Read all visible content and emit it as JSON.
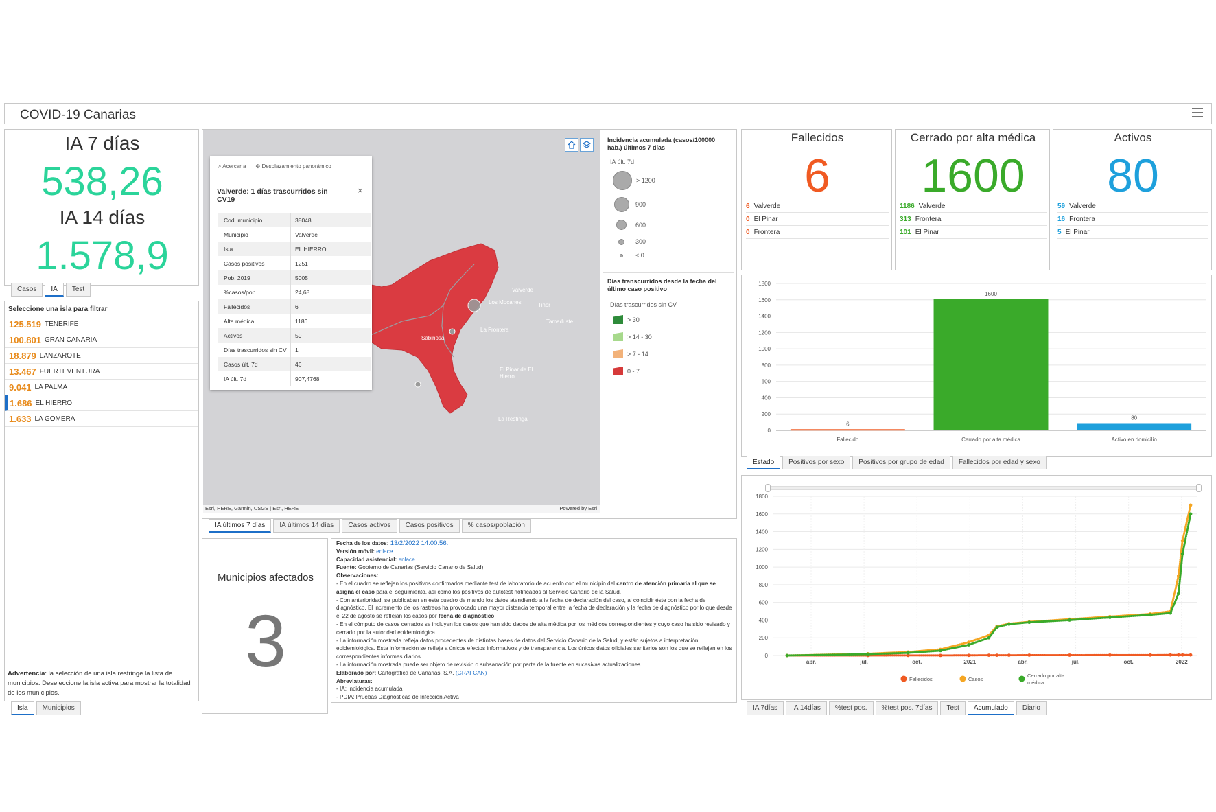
{
  "app_title": "COVID-19 Canarias",
  "ia": {
    "label7": "IA 7 días",
    "value7": "538,26",
    "label14": "IA 14 días",
    "value14": "1.578,9",
    "color": "#2bd49a"
  },
  "left_tabs": [
    "Casos",
    "IA",
    "Test"
  ],
  "island_list": {
    "header": "Seleccione una isla para filtrar",
    "items": [
      {
        "value": "125.519",
        "name": "TENERIFE"
      },
      {
        "value": "100.801",
        "name": "GRAN CANARIA"
      },
      {
        "value": "18.879",
        "name": "LANZAROTE"
      },
      {
        "value": "13.467",
        "name": "FUERTEVENTURA"
      },
      {
        "value": "9.041",
        "name": "LA PALMA"
      },
      {
        "value": "1.686",
        "name": "EL HIERRO"
      },
      {
        "value": "1.633",
        "name": "LA GOMERA"
      }
    ],
    "warning_bold": "Advertencia",
    "warning_text": ": la selección de una isla restringe la lista de municipios. Deseleccione la isla activa para mostrar la totalidad de los municipios."
  },
  "bottom_left_tabs": [
    "Isla",
    "Municipios"
  ],
  "map": {
    "toolbar": {
      "zoom": "Acercar a",
      "pan": "Desplazamiento panorámico"
    },
    "popup_title": "Valverde: 1 días trascurridos sin CV19",
    "popup_rows": [
      {
        "k": "Cod. municipio",
        "v": "38048"
      },
      {
        "k": "Municipio",
        "v": "Valverde"
      },
      {
        "k": "Isla",
        "v": "EL HIERRO"
      },
      {
        "k": "Casos positivos",
        "v": "1251"
      },
      {
        "k": "Pob. 2019",
        "v": "5005"
      },
      {
        "k": "%casos/pob.",
        "v": "24,68"
      },
      {
        "k": "Fallecidos",
        "v": "6"
      },
      {
        "k": "Alta médica",
        "v": "1186"
      },
      {
        "k": "Activos",
        "v": "59"
      },
      {
        "k": "Días trascurridos sin CV",
        "v": "1"
      },
      {
        "k": "Casos últ. 7d",
        "v": "46"
      },
      {
        "k": "IA últ. 7d",
        "v": "907,4768"
      }
    ],
    "places": [
      "Valverde",
      "Los Mocanes",
      "Tiñor",
      "Tamaduste",
      "La Frontera",
      "Sabinosa",
      "El Pinar de El Hierro",
      "La Restinga"
    ],
    "attribution": "Esri, HERE, Garmin, USGS | Esri, HERE",
    "powered": "Powered by Esri",
    "legend1_title": "Incidencia acumulada (casos/100000 hab.) últimos 7 días",
    "legend1_sub": "IA últ. 7d",
    "legend1_items": [
      "> 1200",
      "900",
      "600",
      "300",
      "< 0"
    ],
    "legend2_title": "Días transcurridos desde la fecha del último caso positivo",
    "legend2_sub": "Días trascurridos sin CV",
    "legend2_items": [
      {
        "label": "> 30",
        "color": "#2e8b3a"
      },
      {
        "label": "> 14 - 30",
        "color": "#a7d98c"
      },
      {
        "label": "> 7 - 14",
        "color": "#f2b27a"
      },
      {
        "label": "0 - 7",
        "color": "#d63a3a"
      }
    ]
  },
  "map_tabs": [
    "IA últimos 7 días",
    "IA últimos 14 días",
    "Casos activos",
    "Casos positivos",
    "% casos/población"
  ],
  "municipios": {
    "label": "Municipios afectados",
    "value": "3"
  },
  "notes": {
    "fecha_label": "Fecha de los datos: ",
    "fecha": "13/2/2022 14:00:56.",
    "movil_label": "Versión móvil: ",
    "movil_link": "enlace",
    "capacidad_label": "Capacidad asistencial: ",
    "capacidad_link": "enlace",
    "fuente_label": "Fuente: ",
    "fuente": "Gobierno de Canarias (Servicio Canario de Salud)",
    "obs_label": "Observaciones:",
    "obs1a": "- En el cuadro se reflejan los positivos confirmados mediante test de laboratorio de acuerdo con el municipio del ",
    "obs1b": "centro de atención primaria al que se asigna el caso",
    "obs1c": " para el seguimiento, así como los positivos de autotest notificados al Servicio Canario de la Salud.",
    "obs2a": "- Con anterioridad, se publicaban en este cuadro de mando los datos atendiendo a la fecha de declaración del caso, al coincidir éste con la fecha de diagnóstico. El incremento de los rastreos ha provocado una mayor distancia temporal entre la fecha de declaración y la fecha de diagnóstico por lo que desde el 22 de agosto se reflejan los casos por ",
    "obs2b": "fecha de diagnóstico",
    "obs3": "- En el cómputo de casos cerrados se incluyen los casos que han sido dados de alta médica por los médicos correspondientes y cuyo caso ha sido revisado y cerrado por la autoridad epidemiológica.",
    "obs4": "- La información mostrada refleja datos procedentes de distintas bases de datos del Servicio Canario de la Salud, y están sujetos a interpretación epidemiológica. Esta información se refleja a únicos efectos informativos y de transparencia. Los únicos datos oficiales sanitarios son los que se reflejan en los correspondientes informes diarios.",
    "obs5": "- La información mostrada puede ser objeto de revisión o subsanación por parte de la fuente en sucesivas actualizaciones.",
    "elab_label": "Elaborado por: ",
    "elab": "Cartográfica de Canarias, S.A. ",
    "elab_link": "(GRAFCAN)",
    "abrev_label": "Abreviaturas:",
    "abrev1": "- IA: Incidencia acumulada",
    "abrev2": "- PDIA: Pruebas Diagnósticas de Infección Activa"
  },
  "stats": [
    {
      "title": "Fallecidos",
      "value": "6",
      "color": "#f05a22",
      "rows": [
        {
          "n": "6",
          "name": "Valverde"
        },
        {
          "n": "0",
          "name": "El Pinar"
        },
        {
          "n": "0",
          "name": "Frontera"
        }
      ]
    },
    {
      "title": "Cerrado por alta médica",
      "value": "1600",
      "color": "#3aaa2a",
      "rows": [
        {
          "n": "1186",
          "name": "Valverde"
        },
        {
          "n": "313",
          "name": "Frontera"
        },
        {
          "n": "101",
          "name": "El Pinar"
        }
      ]
    },
    {
      "title": "Activos",
      "value": "80",
      "color": "#1ea0dc",
      "rows": [
        {
          "n": "59",
          "name": "Valverde"
        },
        {
          "n": "16",
          "name": "Frontera"
        },
        {
          "n": "5",
          "name": "El Pinar"
        }
      ]
    }
  ],
  "bar_tabs": [
    "Estado",
    "Positivos por sexo",
    "Positivos por grupo de edad",
    "Fallecidos por edad y sexo"
  ],
  "line_tabs": [
    "IA 7días",
    "IA 14días",
    "%test pos.",
    "%test pos. 7días",
    "Test",
    "Acumulado",
    "Diario"
  ],
  "chart_data": [
    {
      "type": "bar",
      "categories": [
        "Fallecido",
        "Cerrado por alta médica",
        "Activo en domicilio"
      ],
      "values": [
        6,
        1600,
        80
      ],
      "colors": [
        "#f05a22",
        "#3aaa2a",
        "#1ea0dc"
      ],
      "yticks": [
        "0",
        "200",
        "400",
        "600",
        "800",
        "1000",
        "1200",
        "1400",
        "1600",
        "1800"
      ],
      "ylim": [
        0,
        1800
      ]
    },
    {
      "type": "line",
      "xticks": [
        "abr.",
        "jul.",
        "oct.",
        "2021",
        "abr.",
        "jul.",
        "oct.",
        "2022"
      ],
      "yticks": [
        "0",
        "200",
        "400",
        "600",
        "800",
        "1000",
        "1200",
        "1400",
        "1600",
        "1800"
      ],
      "ylim": [
        0,
        1800
      ],
      "x": [
        0,
        0.2,
        0.3,
        0.38,
        0.45,
        0.5,
        0.52,
        0.55,
        0.6,
        0.7,
        0.8,
        0.9,
        0.95,
        0.97,
        0.98,
        1.0
      ],
      "series": [
        {
          "name": "Fallecidos",
          "color": "#f05a22",
          "values": [
            0,
            0,
            1,
            1,
            2,
            3,
            3,
            3,
            4,
            4,
            5,
            5,
            6,
            6,
            6,
            6
          ]
        },
        {
          "name": "Casos",
          "color": "#f5a623",
          "values": [
            0,
            20,
            40,
            70,
            150,
            230,
            330,
            360,
            380,
            410,
            440,
            470,
            500,
            900,
            1300,
            1700
          ]
        },
        {
          "name": "Cerrado por alta médica",
          "color": "#3aaa2a",
          "values": [
            0,
            15,
            30,
            55,
            120,
            200,
            320,
            355,
            375,
            400,
            430,
            460,
            480,
            700,
            1150,
            1600
          ]
        }
      ]
    }
  ]
}
